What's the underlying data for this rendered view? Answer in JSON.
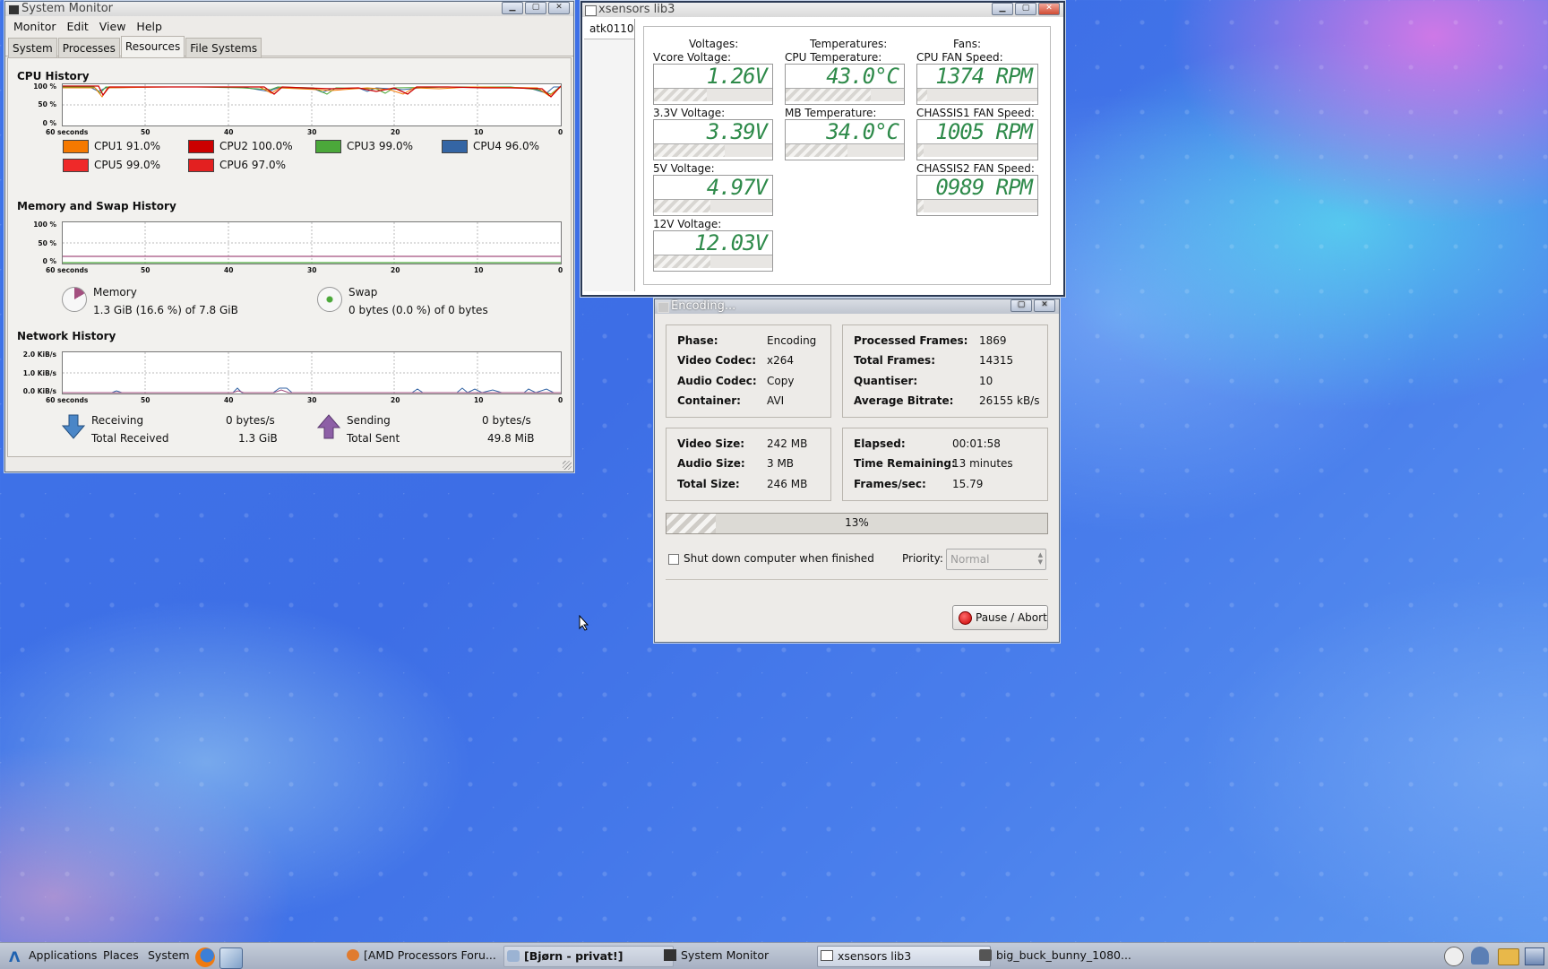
{
  "system_monitor": {
    "title": "System Monitor",
    "menu": [
      "Monitor",
      "Edit",
      "View",
      "Help"
    ],
    "tabs": [
      "System",
      "Processes",
      "Resources",
      "File Systems"
    ],
    "active_tab": "Resources",
    "cpu": {
      "heading": "CPU History",
      "y_ticks": [
        "100 %",
        "50 %",
        "0 %"
      ],
      "x_ticks": [
        "60 seconds",
        "50",
        "40",
        "30",
        "20",
        "10",
        "0"
      ],
      "legend": [
        {
          "label": "CPU1",
          "value": "91.0%",
          "color": "#f57900"
        },
        {
          "label": "CPU2",
          "value": "100.0%",
          "color": "#cc0000"
        },
        {
          "label": "CPU3",
          "value": "99.0%",
          "color": "#4ba83a"
        },
        {
          "label": "CPU4",
          "value": "96.0%",
          "color": "#3465a4"
        },
        {
          "label": "CPU5",
          "value": "99.0%",
          "color": "#ef2929"
        },
        {
          "label": "CPU6",
          "value": "97.0%",
          "color": "#e32020"
        }
      ]
    },
    "memory": {
      "heading": "Memory and Swap History",
      "y_ticks": [
        "100 %",
        "50 %",
        "0 %"
      ],
      "x_ticks": [
        "60 seconds",
        "50",
        "40",
        "30",
        "20",
        "10",
        "0"
      ],
      "mem_label": "Memory",
      "mem_value": "1.3 GiB (16.6 %) of 7.8 GiB",
      "swap_label": "Swap",
      "swap_value": "0 bytes (0.0 %) of 0 bytes"
    },
    "network": {
      "heading": "Network History",
      "y_ticks": [
        "2.0 KiB/s",
        "1.0 KiB/s",
        "0.0 KiB/s"
      ],
      "x_ticks": [
        "60 seconds",
        "50",
        "40",
        "30",
        "20",
        "10",
        "0"
      ],
      "receiving_label": "Receiving",
      "receiving_value": "0 bytes/s",
      "total_received_label": "Total Received",
      "total_received_value": "1.3 GiB",
      "sending_label": "Sending",
      "sending_value": "0 bytes/s",
      "total_sent_label": "Total Sent",
      "total_sent_value": "49.8 MiB"
    }
  },
  "xsensors": {
    "title": "xsensors lib3",
    "chip_tab": "atk0110",
    "headers": {
      "voltages": "Voltages:",
      "temperatures": "Temperatures:",
      "fans": "Fans:"
    },
    "voltages": [
      {
        "label": "Vcore Voltage:",
        "value": "1.26V",
        "level": 0.45
      },
      {
        "label": "3.3V Voltage:",
        "value": "3.39V",
        "level": 0.6
      },
      {
        "label": "5V Voltage:",
        "value": "4.97V",
        "level": 0.48
      },
      {
        "label": "12V Voltage:",
        "value": "12.03V",
        "level": 0.48
      }
    ],
    "temperatures": [
      {
        "label": "CPU Temperature:",
        "value": "43.0°C",
        "level": 0.72
      },
      {
        "label": "MB Temperature:",
        "value": "34.0°C",
        "level": 0.52
      }
    ],
    "fans": [
      {
        "label": "CPU FAN Speed:",
        "value": "1374 RPM",
        "level": 0.08
      },
      {
        "label": "CHASSIS1 FAN Speed:",
        "value": "1005 RPM",
        "level": 0.05
      },
      {
        "label": "CHASSIS2 FAN Speed:",
        "value": "0989 RPM",
        "level": 0.05
      }
    ]
  },
  "encoding": {
    "title": "Encoding...",
    "phase_label": "Phase:",
    "phase": "Encoding",
    "vcodec_label": "Video Codec:",
    "vcodec": "x264",
    "acodec_label": "Audio Codec:",
    "acodec": "Copy",
    "container_label": "Container:",
    "container": "AVI",
    "processed_label": "Processed Frames:",
    "processed": "1869",
    "total_frames_label": "Total Frames:",
    "total_frames": "14315",
    "quantiser_label": "Quantiser:",
    "quantiser": "10",
    "bitrate_label": "Average Bitrate:",
    "bitrate": "26155 kB/s",
    "vsize_label": "Video Size:",
    "vsize": "242 MB",
    "asize_label": "Audio Size:",
    "asize": "3 MB",
    "tsize_label": "Total Size:",
    "tsize": "246 MB",
    "elapsed_label": "Elapsed:",
    "elapsed": "00:01:58",
    "remaining_label": "Time Remaining:",
    "remaining": "13 minutes",
    "fps_label": "Frames/sec:",
    "fps": "15.79",
    "progress_text": "13%",
    "progress": 0.13,
    "shutdown_label": "Shut down computer when finished",
    "priority_label": "Priority:",
    "priority_value": "Normal",
    "pause_label": "Pause / Abort"
  },
  "taskbar": {
    "menus": [
      "Applications",
      "Places",
      "System"
    ],
    "tasks": [
      "[AMD Processors Foru...",
      "[Bjørn - privat!]",
      "System Monitor",
      "xsensors lib3",
      "big_buck_bunny_1080..."
    ]
  }
}
